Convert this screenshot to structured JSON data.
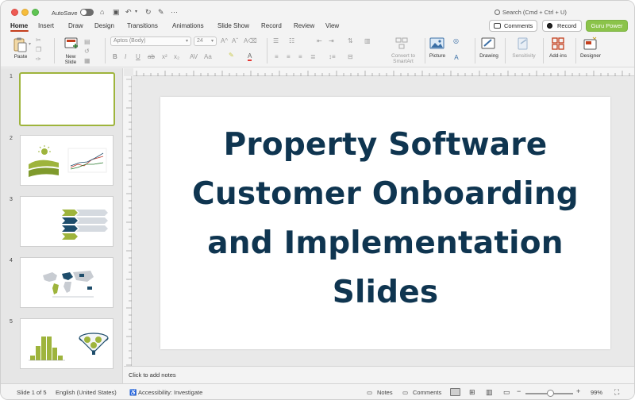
{
  "titlebar": {
    "autosave_label": "AutoSave",
    "search_placeholder": "Search (Cmd + Ctrl + U)"
  },
  "tabs": [
    {
      "label": "Home",
      "active": true
    },
    {
      "label": "Insert"
    },
    {
      "label": "Draw"
    },
    {
      "label": "Design"
    },
    {
      "label": "Transitions"
    },
    {
      "label": "Animations"
    },
    {
      "label": "Slide Show"
    },
    {
      "label": "Record"
    },
    {
      "label": "Review"
    },
    {
      "label": "View"
    }
  ],
  "top_buttons": {
    "comments": "Comments",
    "record": "Record",
    "guru": "Guru Power"
  },
  "ribbon": {
    "paste": "Paste",
    "new_slide": "New\nSlide",
    "font_name": "Aptos (Body)",
    "font_size": "24",
    "convert_smartart": "Convert to\nSmartArt",
    "picture": "Picture",
    "drawing": "Drawing",
    "sensitivity": "Sensitivity",
    "addins": "Add-ins",
    "designer": "Designer"
  },
  "slides": [
    {
      "number": "1"
    },
    {
      "number": "2"
    },
    {
      "number": "3"
    },
    {
      "number": "4"
    },
    {
      "number": "5"
    }
  ],
  "main_slide": {
    "title_lines": [
      "Property Software",
      "Customer Onboarding",
      "and Implementation",
      "Slides"
    ]
  },
  "notes_placeholder": "Click to add notes",
  "status": {
    "slide_counter": "Slide 1 of 5",
    "language": "English (United States)",
    "accessibility": "Accessibility: Investigate",
    "notes": "Notes",
    "comments": "Comments",
    "zoom": "99%"
  },
  "colors": {
    "accent_green": "#9eb43c",
    "title_navy": "#0f3550",
    "record_red": "#c43e1c",
    "guru_green": "#8bc34a"
  }
}
